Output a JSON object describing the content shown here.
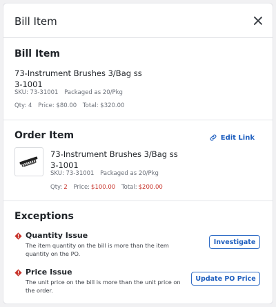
{
  "header": {
    "title": "Bill Item"
  },
  "bill_item": {
    "heading": "Bill Item",
    "name_line1": "73-Instrument Brushes 3/Bag ss",
    "name_line2": "3-1001",
    "sku": "SKU: 73-31001",
    "packaged": "Packaged as 20/Pkg",
    "qty": "Qty: 4",
    "price": "Price: $80.00",
    "total": "Total: $320.00"
  },
  "order_item": {
    "heading": "Order Item",
    "edit_link": "Edit Link",
    "name_line1": "73-Instrument Brushes 3/Bag ss",
    "name_line2": "3-1001",
    "sku": "SKU: 73-31001",
    "packaged": "Packaged as 20/Pkg",
    "qty_label": "Qty:",
    "qty_value": "2",
    "price_label": "Price:",
    "price_value": "$100.00",
    "total_label": "Total:",
    "total_value": "$200.00"
  },
  "exceptions": {
    "heading": "Exceptions",
    "items": [
      {
        "title": "Quantity Issue",
        "description": "The item quantity on the bill is more than the item quantity on the PO.",
        "action": "Investigate"
      },
      {
        "title": "Price Issue",
        "description": "The unit price on the bill is more than the unit price on the order.",
        "action": "Update PO Price"
      }
    ]
  },
  "colors": {
    "accent": "#1f5fbf",
    "error": "#c8352c",
    "warning_icon": "#c8352c"
  },
  "icons": [
    "close-icon",
    "link-icon",
    "warning-icon",
    "product-thumbnail"
  ]
}
